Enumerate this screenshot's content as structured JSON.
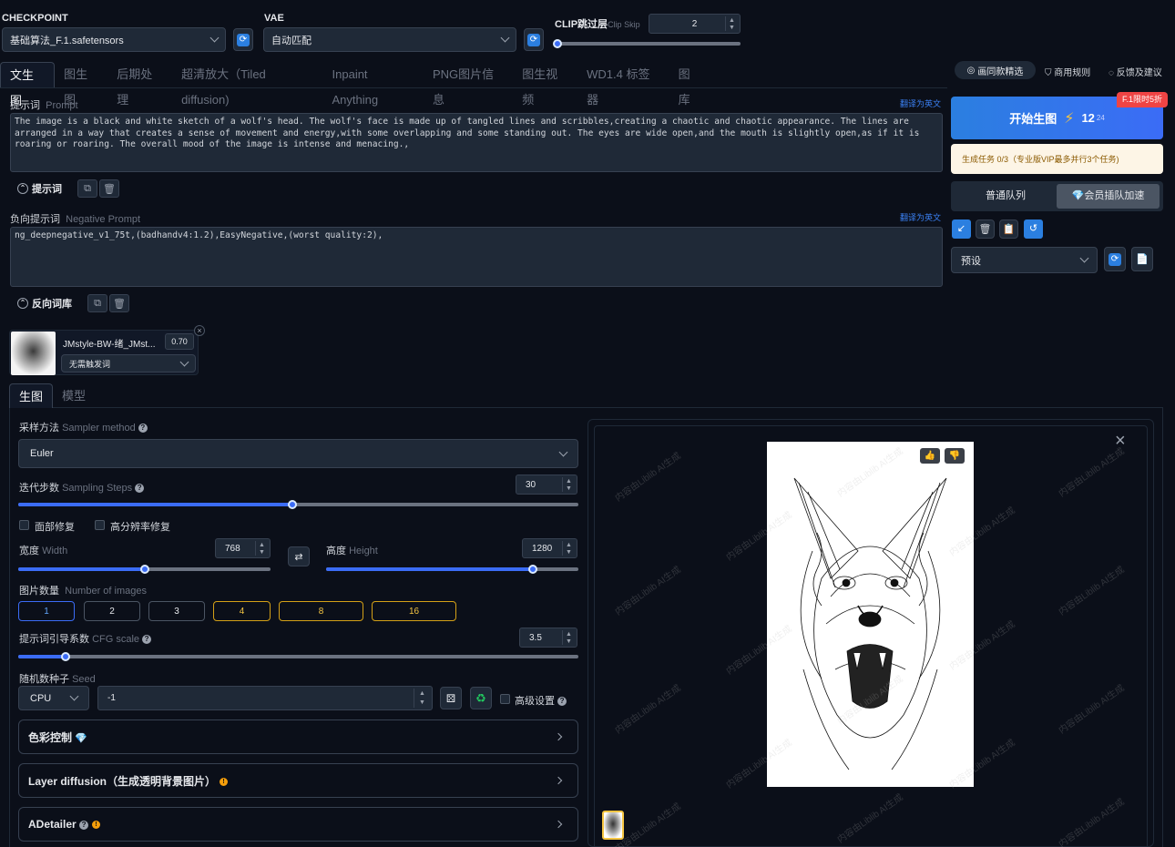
{
  "top": {
    "checkpoint_label": "CHECKPOINT",
    "checkpoint_value": "基础算法_F.1.safetensors",
    "vae_label": "VAE",
    "vae_value": "自动匹配",
    "clip_label": "CLIP跳过层",
    "clip_label_en": "Clip Skip",
    "clip_value": "2",
    "clip_level": 0.0
  },
  "tabs": [
    "文生图",
    "图生图",
    "后期处理",
    "超清放大（Tiled diffusion)",
    "Inpaint Anything",
    "PNG图片信息",
    "图生视频",
    "WD1.4 标签器",
    "图库"
  ],
  "active_tab": "文生图",
  "top_links": {
    "gallery": "画同款精选",
    "rules": "商用规则",
    "feedback": "反馈及建议"
  },
  "prompt": {
    "label": "提示词",
    "label_en": "Prompt",
    "translate": "翻译为英文",
    "text": "The image is a black and white sketch of a wolf's head. The wolf's face is made up of tangled lines and scribbles,creating a chaotic and chaotic appearance. The lines are arranged in a way that creates a sense of movement and energy,with some overlapping and some standing out. The eyes are wide open,and the mouth is slightly open,as if it is roaring or roaring. The overall mood of the image is intense and menacing.,",
    "library_label": "提示词"
  },
  "negative": {
    "label": "负向提示词",
    "label_en": "Negative Prompt",
    "translate": "翻译为英文",
    "text": "ng_deepnegative_v1_75t,(badhandv4:1.2),EasyNegative,(worst quality:2),",
    "library_label": "反向词库"
  },
  "lora": {
    "name": "JMstyle-BW-绪_JMst...",
    "weight": "0.70",
    "trigger": "无需触发词"
  },
  "sub_tabs": [
    "生图",
    "模型"
  ],
  "sampler": {
    "label": "采样方法",
    "label_en": "Sampler method",
    "value": "Euler"
  },
  "steps": {
    "label": "迭代步数",
    "label_en": "Sampling Steps",
    "value": "30",
    "level": 0.49
  },
  "checks": {
    "face": "面部修复",
    "hires": "高分辨率修复"
  },
  "width": {
    "label": "宽度",
    "label_en": "Width",
    "value": "768",
    "level": 0.5
  },
  "height": {
    "label": "高度",
    "label_en": "Height",
    "value": "1280",
    "level": 0.82
  },
  "num_images": {
    "label": "图片数量",
    "label_en": "Number of images",
    "options": [
      "1",
      "2",
      "3",
      "4",
      "8",
      "16"
    ],
    "selected": "1"
  },
  "cfg": {
    "label": "提示词引导系数",
    "label_en": "CFG scale",
    "value": "3.5",
    "level": 0.085
  },
  "seed": {
    "label": "随机数种子",
    "label_en": "Seed",
    "device": "CPU",
    "value": "-1",
    "advanced": "高级设置"
  },
  "accordions": [
    {
      "label": "色彩控制"
    },
    {
      "label": "Layer diffusion（生成透明背景图片）"
    },
    {
      "label": "ADetailer"
    }
  ],
  "generate": {
    "label": "开始生图",
    "credits": "12",
    "credits_sub": "24",
    "promo": "F.1限时5折"
  },
  "task_status": "生成任务 0/3（专业版VIP最多并行3个任务)",
  "queue": {
    "normal": "普通队列",
    "vip": "会员插队加速"
  },
  "preset": {
    "value": "预设"
  },
  "watermark_text": "内容由Liblib AI生成",
  "colors": {
    "accent": "#3b6cf6",
    "gold": "#f5c542",
    "promo": "#ef4444"
  }
}
